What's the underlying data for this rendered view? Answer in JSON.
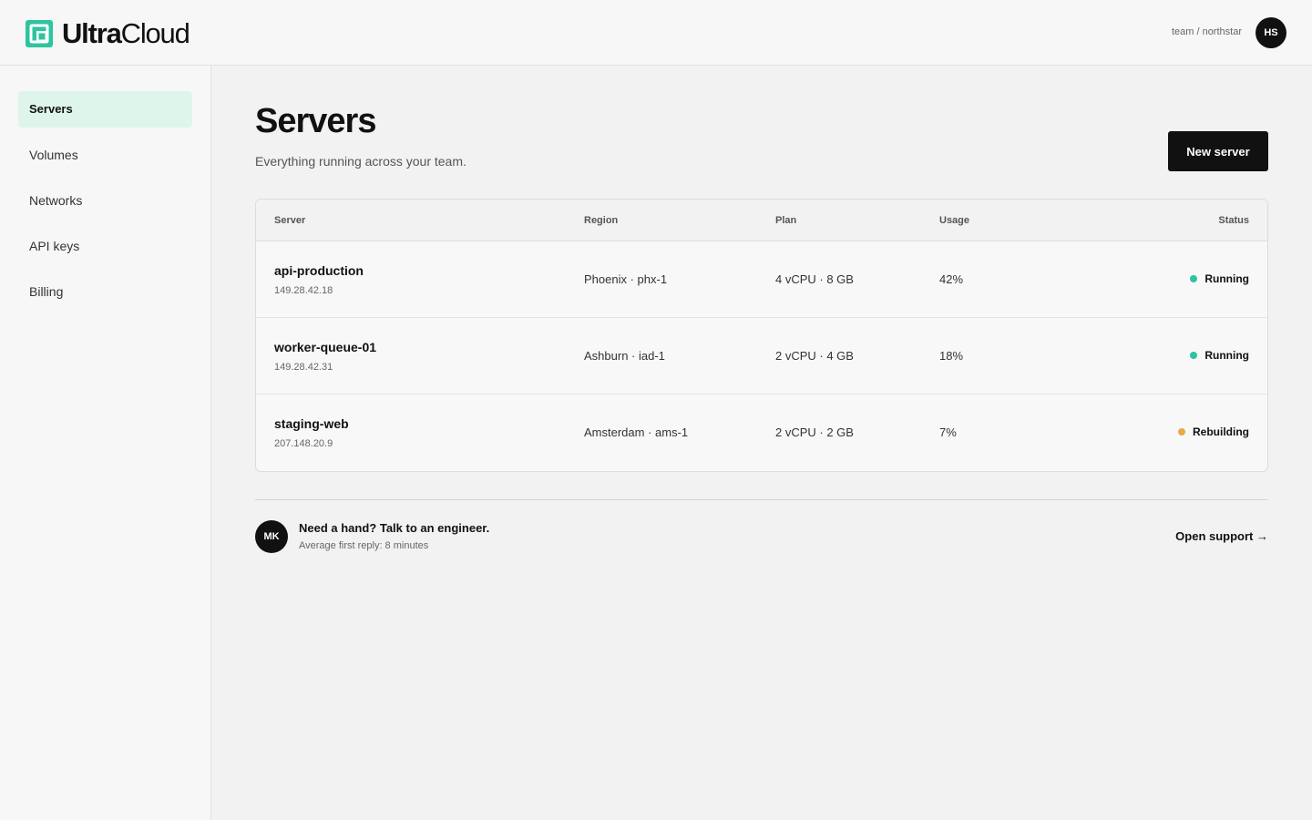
{
  "brand": {
    "name_strong": "Ultra",
    "name_rest": "Cloud",
    "accent": "#2ec4a0"
  },
  "header": {
    "team_path": "team / northstar",
    "user_initials": "HS"
  },
  "sidebar": {
    "items": [
      {
        "label": "Servers",
        "active": true
      },
      {
        "label": "Volumes",
        "active": false
      },
      {
        "label": "Networks",
        "active": false
      },
      {
        "label": "API keys",
        "active": false
      },
      {
        "label": "Billing",
        "active": false
      }
    ]
  },
  "page": {
    "title": "Servers",
    "subtitle": "Everything running across your team.",
    "new_button": "New server"
  },
  "table": {
    "columns": [
      "Server",
      "Region",
      "Plan",
      "Usage",
      "Status"
    ],
    "rows": [
      {
        "name": "api-production",
        "ip": "149.28.42.18",
        "region": "Phoenix · phx-1",
        "plan": "4 vCPU · 8 GB",
        "usage": "42%",
        "status": "Running",
        "status_color": "#2ec4a0"
      },
      {
        "name": "worker-queue-01",
        "ip": "149.28.42.31",
        "region": "Ashburn · iad-1",
        "plan": "2 vCPU · 4 GB",
        "usage": "18%",
        "status": "Running",
        "status_color": "#2ec4a0"
      },
      {
        "name": "staging-web",
        "ip": "207.148.20.9",
        "region": "Amsterdam · ams-1",
        "plan": "2 vCPU · 2 GB",
        "usage": "7%",
        "status": "Rebuilding",
        "status_color": "#e8a94a"
      }
    ]
  },
  "help": {
    "initials": "MK",
    "title": "Need a hand? Talk to an engineer.",
    "subtitle": "Average first reply: 8 minutes",
    "link": "Open support →"
  }
}
